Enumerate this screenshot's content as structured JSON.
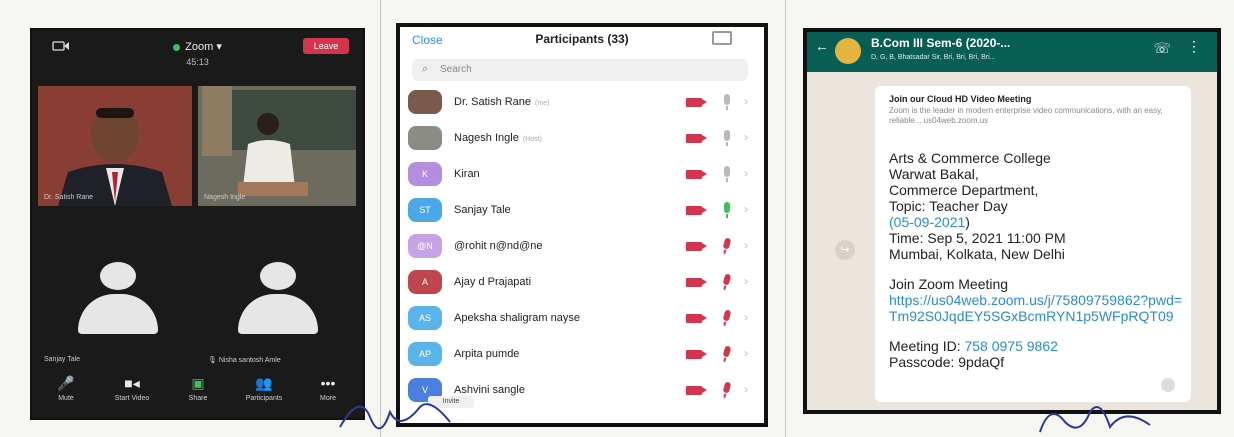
{
  "zoom": {
    "title": "Zoom",
    "time": "45:13",
    "leave_label": "Leave",
    "tiles": [
      "Dr. Satish Rane",
      "Nagesh Ingle"
    ],
    "avatar_names": [
      "Sanjay Tale",
      "Nisha santosh Amle"
    ],
    "toolbar": [
      {
        "label": "Mute",
        "icon": "microphone-icon"
      },
      {
        "label": "Start Video",
        "icon": "video-camera-icon"
      },
      {
        "label": "Share",
        "icon": "share-screen-icon"
      },
      {
        "label": "Participants",
        "icon": "participants-icon"
      },
      {
        "label": "More",
        "icon": "more-icon"
      }
    ],
    "colors": {
      "background": "#1a1a1a",
      "leave": "#d6334d",
      "share": "#3cbf5c"
    }
  },
  "participants": {
    "close_label": "Close",
    "title": "Participants (33)",
    "search_placeholder": "Search",
    "invite_label": "Invite",
    "rows": [
      {
        "name": "Dr. Satish Rane",
        "tag": "(me)",
        "initials": "",
        "avatar_color": "#7a5a4a",
        "mic": "muted-grey"
      },
      {
        "name": "Nagesh Ingle",
        "tag": "(Host)",
        "initials": "",
        "avatar_color": "#8c8c86",
        "mic": "muted-grey"
      },
      {
        "name": "Kiran",
        "tag": "",
        "initials": "K",
        "avatar_color": "#b48ce0",
        "mic": "muted-grey"
      },
      {
        "name": "Sanjay Tale",
        "tag": "",
        "initials": "ST",
        "avatar_color": "#4aa7e8",
        "mic": "on"
      },
      {
        "name": "@rohit n@nd@ne",
        "tag": "",
        "initials": "@N",
        "avatar_color": "#c8a2e6",
        "mic": "off"
      },
      {
        "name": "Ajay d Prajapati",
        "tag": "",
        "initials": "A",
        "avatar_color": "#c0464e",
        "mic": "off"
      },
      {
        "name": "Apeksha shaligram nayse",
        "tag": "",
        "initials": "AS",
        "avatar_color": "#5ab4ec",
        "mic": "off"
      },
      {
        "name": "Arpita pumde",
        "tag": "",
        "initials": "AP",
        "avatar_color": "#5ab4ec",
        "mic": "off"
      },
      {
        "name": "Ashvini sangle",
        "tag": "",
        "initials": "V",
        "avatar_color": "#4a7fe0",
        "mic": "off"
      }
    ]
  },
  "whatsapp": {
    "group_name": "B.Com III Sem-6 (2020-...",
    "group_members": "D, G, B, Bhatsadar Sir, Bri, Bri, Bri, Bri...",
    "link_preview_title": "Join our Cloud HD Video Meeting",
    "link_preview_desc": "Zoom is the leader in modern enterprise video communications, with an easy, reliable... us04web.zoom.us",
    "message": {
      "line1": "Arts & Commerce College",
      "line2": "Warwat Bakal,",
      "line3": "Commerce Department,",
      "line4": "Topic: Teacher Day",
      "date_link": "(05-09-2021",
      "date_close": ")",
      "time": "Time: Sep 5, 2021 11:00 PM",
      "tz": "Mumbai, Kolkata, New Delhi",
      "join": "Join Zoom Meeting",
      "url": "https://us04web.zoom.us/j/75809759862?pwd=Tm92S0JqdEY5SGxBcmRYN1p5WFpRQT09",
      "meeting_id_label": "Meeting ID: ",
      "meeting_id": "758 0975 9862",
      "passcode": "Passcode: 9pdaQf"
    },
    "colors": {
      "bar": "#075e54",
      "link": "#2a8cd4",
      "chat_bg": "#ece5dd"
    }
  }
}
